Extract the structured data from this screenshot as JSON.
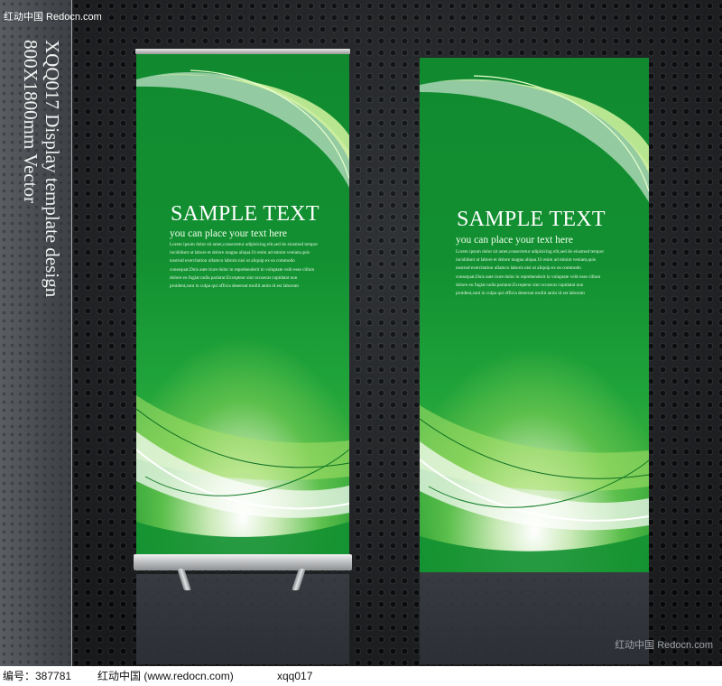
{
  "watermark_top": "红动中国 Redocn.com",
  "side_caption": {
    "line1": "XQQ017 Display template design",
    "line2": "800X1800mm Vector"
  },
  "banner_left": {
    "title": "SAMPLE TEXT",
    "subtitle": "you can place your text here",
    "body": [
      "Lorem ipsum dolor sit amet,consectetur adipisicing elit,sed do eiusmod tempor",
      "incididunt ut labore et dolore magna aliqua.Ut enim ad minim veniam,quis",
      "nostrud exercitation ullamco laboris nisi ut aliquip ex ea commodo",
      "consequat.Duis aute irure dolor in reprehenderit in voluptate velit esse cillum",
      "dolore eu fugiat nulla pariatur.Excepteur sint occaecat cupidatat non",
      "proident,sunt in culpa qui officia deserunt mollit anim id est laborum"
    ]
  },
  "banner_right": {
    "title": "SAMPLE TEXT",
    "subtitle": "you can place your text here",
    "body": [
      "Lorem ipsum dolor sit amet,consectetur adipisicing elit,sed do eiusmod tempor",
      "incididunt ut labore et dolore magna aliqua.Ut enim ad minim veniam,quis",
      "nostrud exercitation ullamco laboris nisi ut aliquip ex ea commodo",
      "consequat.Duis aute irure dolor in reprehenderit in voluptate velit esse cillum",
      "dolore eu fugiat nulla pariatur.Excepteur sint occaecat cupidatat non",
      "proident,sunt in culpa qui officia deserunt mollit anim id est laborum"
    ]
  },
  "watermark_bottom": "红动中国 Redocn.com",
  "footer": {
    "id_label": "编号：387781",
    "site": "红动中国 (www.redocn.com)",
    "code": "xqq017"
  },
  "colors": {
    "banner_green": "#129031",
    "background": "#26282b",
    "swoosh_light": "#c8f08a"
  }
}
